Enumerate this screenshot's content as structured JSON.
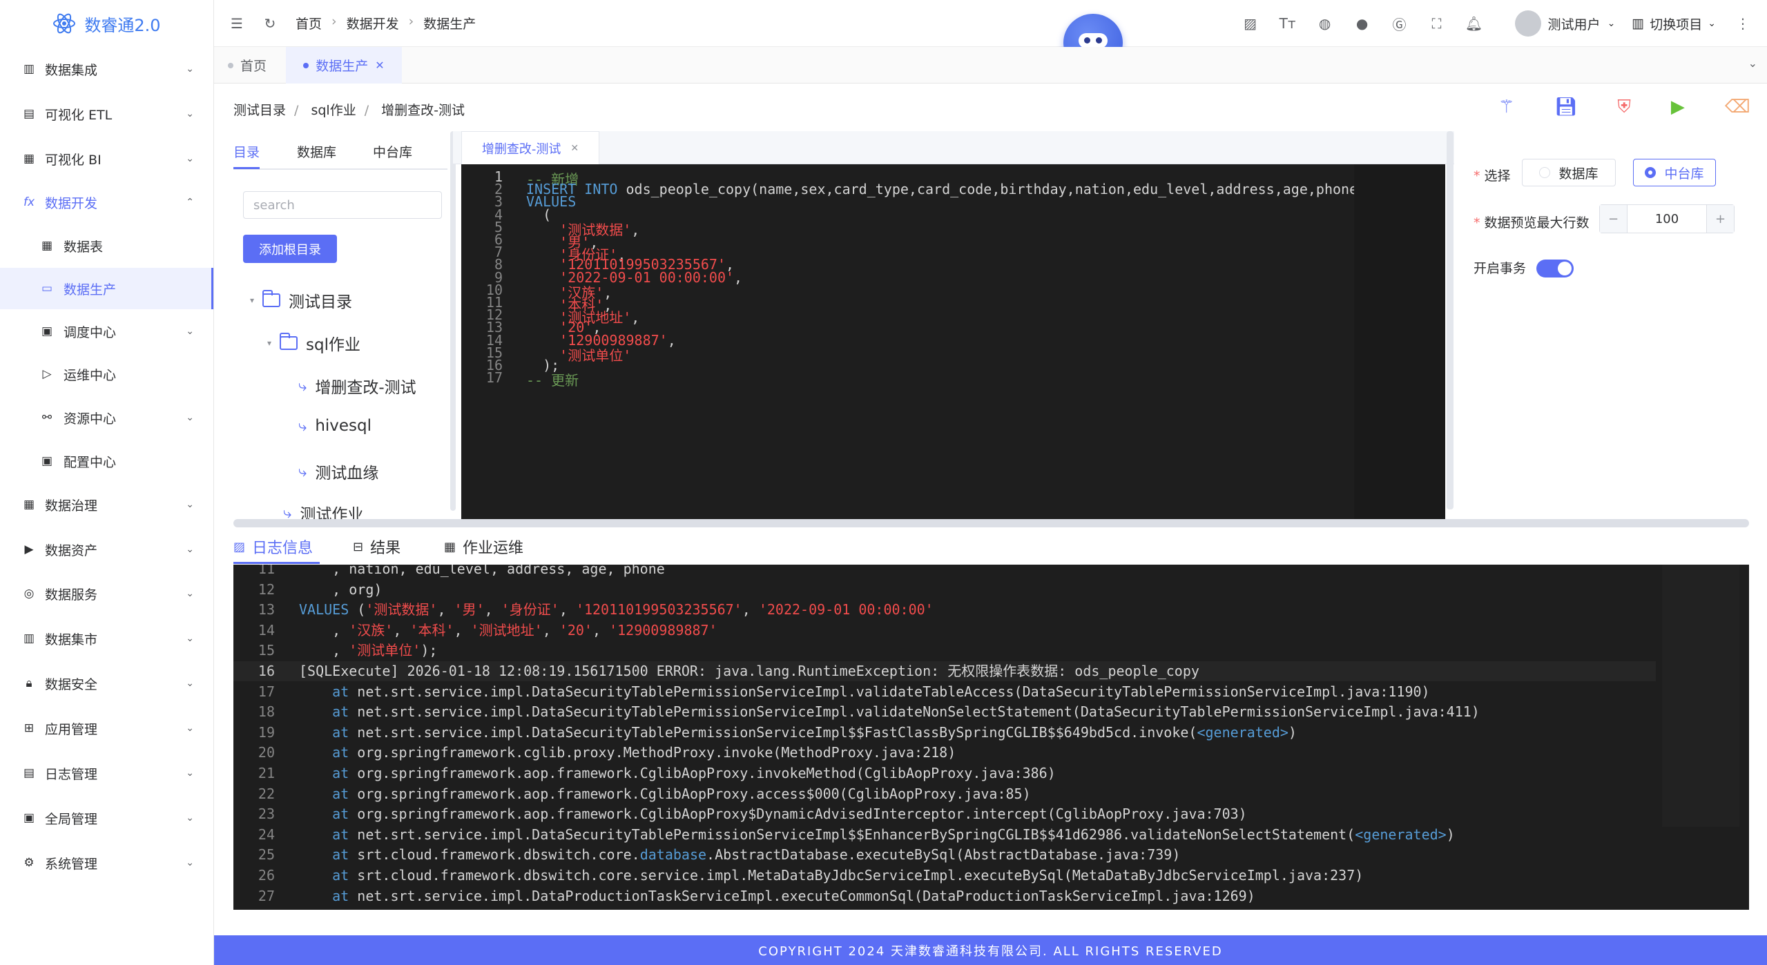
{
  "app": {
    "title": "数睿通2.0"
  },
  "sidebar": {
    "items": [
      {
        "label": "数据集成",
        "icon": "integration-icon"
      },
      {
        "label": "可视化 ETL",
        "icon": "etl-icon"
      },
      {
        "label": "可视化 BI",
        "icon": "bi-icon"
      },
      {
        "label": "数据开发",
        "icon": "fx-icon"
      },
      {
        "label": "数据表",
        "icon": "table-icon"
      },
      {
        "label": "数据生产",
        "icon": "monitor-icon"
      },
      {
        "label": "调度中心",
        "icon": "calendar-icon"
      },
      {
        "label": "运维中心",
        "icon": "send-icon"
      },
      {
        "label": "资源中心",
        "icon": "share-icon"
      },
      {
        "label": "配置中心",
        "icon": "config-icon"
      },
      {
        "label": "数据治理",
        "icon": "grid-icon"
      },
      {
        "label": "数据资产",
        "icon": "terminal-icon"
      },
      {
        "label": "数据服务",
        "icon": "service-icon"
      },
      {
        "label": "数据集市",
        "icon": "market-icon"
      },
      {
        "label": "数据安全",
        "icon": "lock-icon"
      },
      {
        "label": "应用管理",
        "icon": "apps-icon"
      },
      {
        "label": "日志管理",
        "icon": "log-icon"
      },
      {
        "label": "全局管理",
        "icon": "global-icon"
      },
      {
        "label": "系统管理",
        "icon": "gear-icon"
      }
    ]
  },
  "header": {
    "breadcrumb": [
      "首页",
      "数据开发",
      "数据生产"
    ],
    "user": "测试用户",
    "switch_project": "切换项目"
  },
  "tags": {
    "home": "首页",
    "current": "数据生产"
  },
  "workspace": {
    "breadcrumb": [
      "测试目录",
      "sql作业",
      "增删查改-测试"
    ],
    "tabs": [
      "目录",
      "数据库",
      "中台库"
    ],
    "search_placeholder": "search",
    "add_root": "添加根目录",
    "tree": {
      "root": "测试目录",
      "folder": "sql作业",
      "items": [
        "增删查改-测试",
        "hivesql",
        "测试血缘"
      ],
      "cut": "测试作业"
    }
  },
  "editor": {
    "tab": "增删查改-测试",
    "lines": [
      "-- 新增",
      "INSERT INTO ods_people_copy(name,sex,card_type,card_code,birthday,nation,edu_level,address,age,phone,",
      "VALUES",
      "  (",
      "    '测试数据',",
      "    '男',",
      "    '身份证',",
      "    '120110199503235567',",
      "    '2022-09-01 00:00:00',",
      "    '汉族',",
      "    '本科',",
      "    '测试地址',",
      "    '20',",
      "    '12900989887',",
      "    '测试单位'",
      "  );",
      "-- 更新"
    ]
  },
  "settings": {
    "select_label": "选择",
    "opt_db": "数据库",
    "opt_mid": "中台库",
    "preview_label": "数据预览最大行数",
    "preview_value": "100",
    "txn_label": "开启事务"
  },
  "bottom": {
    "tabs": [
      "日志信息",
      "结果",
      "作业运维"
    ],
    "log_start": 11,
    "log_lines": [
      "    , nation, edu_level, address, age, phone",
      "    , org)",
      "VALUES ('测试数据', '男', '身份证', '120110199503235567', '2022-09-01 00:00:00'",
      "    , '汉族', '本科', '测试地址', '20', '12900989887'",
      "    , '测试单位');",
      "[SQLExecute] 2026-01-18 12:08:19.156171500 ERROR: java.lang.RuntimeException: 无权限操作表数据: ods_people_copy",
      "    at net.srt.service.impl.DataSecurityTablePermissionServiceImpl.validateTableAccess(DataSecurityTablePermissionServiceImpl.java:1190)",
      "    at net.srt.service.impl.DataSecurityTablePermissionServiceImpl.validateNonSelectStatement(DataSecurityTablePermissionServiceImpl.java:411)",
      "    at net.srt.service.impl.DataSecurityTablePermissionServiceImpl$$FastClassBySpringCGLIB$$649bd5cd.invoke(<generated>)",
      "    at org.springframework.cglib.proxy.MethodProxy.invoke(MethodProxy.java:218)",
      "    at org.springframework.aop.framework.CglibAopProxy.invokeMethod(CglibAopProxy.java:386)",
      "    at org.springframework.aop.framework.CglibAopProxy.access$000(CglibAopProxy.java:85)",
      "    at org.springframework.aop.framework.CglibAopProxy$DynamicAdvisedInterceptor.intercept(CglibAopProxy.java:703)",
      "    at net.srt.service.impl.DataSecurityTablePermissionServiceImpl$$EnhancerBySpringCGLIB$$41d62986.validateNonSelectStatement(<generated>)",
      "    at srt.cloud.framework.dbswitch.core.database.AbstractDatabase.executeBySql(AbstractDatabase.java:739)",
      "    at srt.cloud.framework.dbswitch.core.service.impl.MetaDataByJdbcServiceImpl.executeBySql(MetaDataByJdbcServiceImpl.java:237)",
      "    at net.srt.service.impl.DataProductionTaskServiceImpl.executeCommonSql(DataProductionTaskServiceImpl.java:1269)"
    ]
  },
  "footer": "COPYRIGHT 2024 天津数睿通科技有限公司. ALL RIGHTS RESERVED",
  "colors": {
    "accent": "#5b6ef5",
    "editor_bg": "#1e1e1e",
    "string": "#f14c4c",
    "keyword": "#569cd6",
    "comment": "#6a9955"
  }
}
